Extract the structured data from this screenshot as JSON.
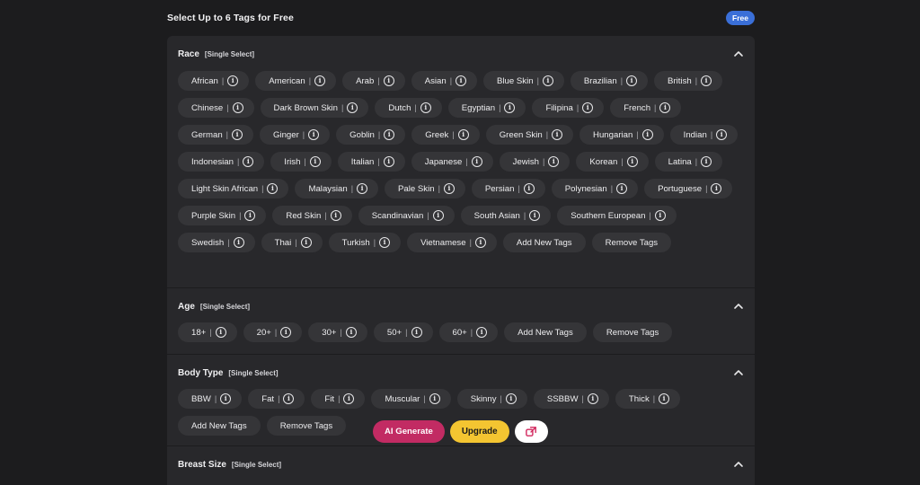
{
  "header": {
    "title": "Select Up to 6 Tags for Free",
    "badge": "Free"
  },
  "sections": [
    {
      "title": "Race",
      "subtitle": "[Single Select]",
      "tags": [
        "African",
        "American",
        "Arab",
        "Asian",
        "Blue Skin",
        "Brazilian",
        "British",
        "Chinese",
        "Dark Brown Skin",
        "Dutch",
        "Egyptian",
        "Filipina",
        "French",
        "German",
        "Ginger",
        "Goblin",
        "Greek",
        "Green Skin",
        "Hungarian",
        "Indian",
        "Indonesian",
        "Irish",
        "Italian",
        "Japanese",
        "Jewish",
        "Korean",
        "Latina",
        "Light Skin African",
        "Malaysian",
        "Pale Skin",
        "Persian",
        "Polynesian",
        "Portuguese",
        "Purple Skin",
        "Red Skin",
        "Scandinavian",
        "South Asian",
        "Southern European",
        "Swedish",
        "Thai",
        "Turkish",
        "Vietnamese"
      ],
      "actions": [
        "Add New Tags",
        "Remove Tags"
      ]
    },
    {
      "title": "Age",
      "subtitle": "[Single Select]",
      "tags": [
        "18+",
        "20+",
        "30+",
        "50+",
        "60+"
      ],
      "actions": [
        "Add New Tags",
        "Remove Tags"
      ]
    },
    {
      "title": "Body Type",
      "subtitle": "[Single Select]",
      "tags": [
        "BBW",
        "Fat",
        "Fit",
        "Muscular",
        "Skinny",
        "SSBBW",
        "Thick"
      ],
      "actions": [
        "Add New Tags",
        "Remove Tags"
      ]
    },
    {
      "title": "Breast Size",
      "subtitle": "[Single Select]",
      "tags": [],
      "actions": []
    }
  ],
  "info_glyph": "i",
  "separator": "|",
  "floating_actions": {
    "generate": "AI Generate",
    "upgrade": "Upgrade",
    "share_icon": "share-icon"
  },
  "colors": {
    "background": "#1c1c1e",
    "panel": "#28282b",
    "chip": "#353538",
    "generate": "#c22b63",
    "upgrade": "#f4c531",
    "badge": "#3a6fd8"
  }
}
